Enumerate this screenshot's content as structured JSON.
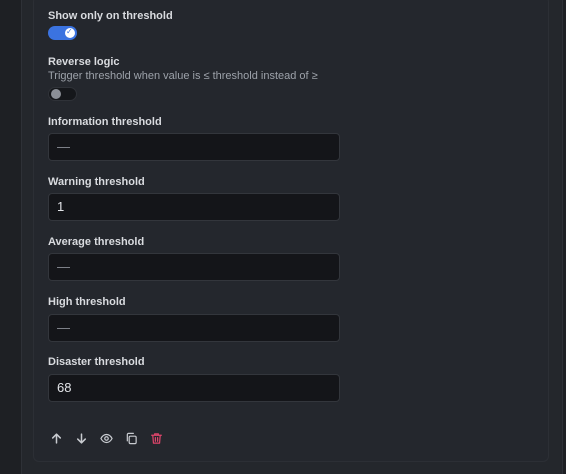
{
  "show_only": {
    "label": "Show only on threshold",
    "enabled": true
  },
  "reverse": {
    "label": "Reverse logic",
    "hint": "Trigger threshold when value is ≤ threshold instead of ≥",
    "enabled": false
  },
  "thresholds": [
    {
      "label": "Information threshold",
      "value": "—"
    },
    {
      "label": "Warning threshold",
      "value": "1"
    },
    {
      "label": "Average threshold",
      "value": "—"
    },
    {
      "label": "High threshold",
      "value": "—"
    },
    {
      "label": "Disaster threshold",
      "value": "68"
    }
  ],
  "toolbar": {
    "icons": [
      "arrow-up-icon",
      "arrow-down-icon",
      "eye-icon",
      "copy-icon",
      "trash-icon"
    ],
    "delete_color": "#e0456b"
  },
  "colors": {
    "accent": "#3b73e0",
    "background": "#1e2024",
    "card": "#24272d"
  }
}
